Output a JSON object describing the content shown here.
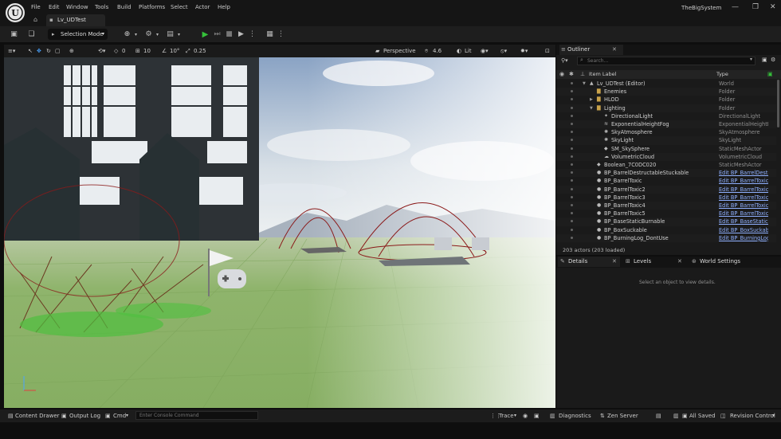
{
  "app": {
    "project_name": "TheBigSystem",
    "level_tab": "Lv_UDTest"
  },
  "menu": [
    "File",
    "Edit",
    "Window",
    "Tools",
    "Build",
    "Platforms",
    "Select",
    "Actor",
    "Help"
  ],
  "window_controls": [
    "—",
    "❐",
    "✕"
  ],
  "toolbar": {
    "mode": "Selection Mode"
  },
  "viewport_toolbar": {
    "rotation_snap": "0",
    "grid_snap": "10",
    "angle_snap": "10°",
    "scale_snap": "0.25",
    "view_mode": "Perspective",
    "fov": "4.6",
    "lighting": "Lit"
  },
  "outliner": {
    "title": "Outliner",
    "search_placeholder": "Search...",
    "col_label": "Item Label",
    "col_type": "Type",
    "rows": [
      {
        "label": "Lv_UDTest (Editor)",
        "type": "World",
        "indent": 0,
        "icon": "level"
      },
      {
        "label": "Enemies",
        "type": "Folder",
        "indent": 1,
        "icon": "folder"
      },
      {
        "label": "HLOD",
        "type": "Folder",
        "indent": 1,
        "icon": "folder"
      },
      {
        "label": "Lighting",
        "type": "Folder",
        "indent": 1,
        "icon": "folder"
      },
      {
        "label": "DirectionalLight",
        "type": "DirectionalLight",
        "indent": 2,
        "icon": "light"
      },
      {
        "label": "ExponentialHeightFog",
        "type": "ExponentialHeightFog",
        "indent": 2,
        "icon": "fog"
      },
      {
        "label": "SkyAtmosphere",
        "type": "SkyAtmosphere",
        "indent": 2,
        "icon": "sky"
      },
      {
        "label": "SkyLight",
        "type": "SkyLight",
        "indent": 2,
        "icon": "sky"
      },
      {
        "label": "SM_SkySphere",
        "type": "StaticMeshActor",
        "indent": 2,
        "icon": "mesh"
      },
      {
        "label": "VolumetricCloud",
        "type": "VolumetricCloud",
        "indent": 2,
        "icon": "cloud"
      },
      {
        "label": "Boolean_7C0DC020",
        "type": "StaticMeshActor",
        "indent": 1,
        "icon": "mesh"
      },
      {
        "label": "BP_BarrelDestructableStuckable",
        "type": "Edit BP_BarrelDestru",
        "indent": 1,
        "icon": "actor"
      },
      {
        "label": "BP_BarrelToxic",
        "type": "Edit BP_BarrelToxic",
        "indent": 1,
        "icon": "actor"
      },
      {
        "label": "BP_BarrelToxic2",
        "type": "Edit BP_BarrelToxic",
        "indent": 1,
        "icon": "actor"
      },
      {
        "label": "BP_BarrelToxic3",
        "type": "Edit BP_BarrelToxic",
        "indent": 1,
        "icon": "actor"
      },
      {
        "label": "BP_BarrelToxic4",
        "type": "Edit BP_BarrelToxic",
        "indent": 1,
        "icon": "actor"
      },
      {
        "label": "BP_BarrelToxic5",
        "type": "Edit BP_BarrelToxic",
        "indent": 1,
        "icon": "actor"
      },
      {
        "label": "BP_BaseStaticBurnable",
        "type": "Edit BP_BaseStaticB",
        "indent": 1,
        "icon": "actor"
      },
      {
        "label": "BP_BoxSuckable",
        "type": "Edit BP_BoxSuckable",
        "indent": 1,
        "icon": "actor"
      },
      {
        "label": "BP_BurningLog_DontUse",
        "type": "Edit BP_BurningLog_",
        "indent": 1,
        "icon": "actor"
      }
    ],
    "actor_count": "203 actors (203 loaded)"
  },
  "details": {
    "tabs": [
      "Details",
      "Levels",
      "World Settings"
    ],
    "empty_message": "Select an object to view details."
  },
  "statusbar": {
    "content_drawer": "Content Drawer",
    "output_log": "Output Log",
    "cmd": "Cmd",
    "console_placeholder": "Enter Console Command",
    "trace": "Trace",
    "derived_data": "Diagnostics",
    "zen_server": "Zen Server",
    "all_saved": "All Saved",
    "revision_control": "Revision Control"
  },
  "colors": {
    "play_green": "#35c13a",
    "link_blue": "#8fb0ff",
    "panel": "#1a1a1a",
    "ground": "#8fb46c"
  }
}
